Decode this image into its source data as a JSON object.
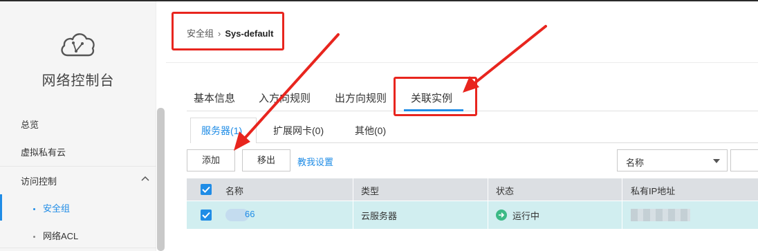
{
  "sidebar": {
    "title": "网络控制台",
    "items": [
      {
        "label": "总览"
      },
      {
        "label": "虚拟私有云"
      }
    ],
    "group": {
      "label": "访问控制",
      "expanded": true
    },
    "sub_items": [
      {
        "label": "安全组",
        "active": true
      },
      {
        "label": "网络ACL",
        "active": false
      }
    ],
    "logo_icon": "cloud-icon"
  },
  "breadcrumb": {
    "parent": "安全组",
    "separator": "›",
    "current": "Sys-default"
  },
  "main_tabs": [
    {
      "label": "基本信息",
      "active": false
    },
    {
      "label": "入方向规则",
      "active": false
    },
    {
      "label": "出方向规则",
      "active": false
    },
    {
      "label": "关联实例",
      "active": true
    }
  ],
  "sub_tabs": [
    {
      "label": "服务器(1)",
      "active": true
    },
    {
      "label": "扩展网卡(0)",
      "active": false
    },
    {
      "label": "其他(0)",
      "active": false
    }
  ],
  "toolbar": {
    "add_label": "添加",
    "remove_label": "移出",
    "help_link": "教我设置",
    "filter_select": "名称"
  },
  "table": {
    "columns": [
      "名称",
      "类型",
      "状态",
      "私有IP地址"
    ],
    "rows": [
      {
        "name_suffix": "66",
        "type": "云服务器",
        "status": "运行中",
        "checked": true
      }
    ],
    "header_checked": true
  },
  "colors": {
    "accent": "#1f8ce6",
    "annotation_red": "#e8251e",
    "row_selected": "#d1eef0",
    "status_running": "#3cba86"
  }
}
